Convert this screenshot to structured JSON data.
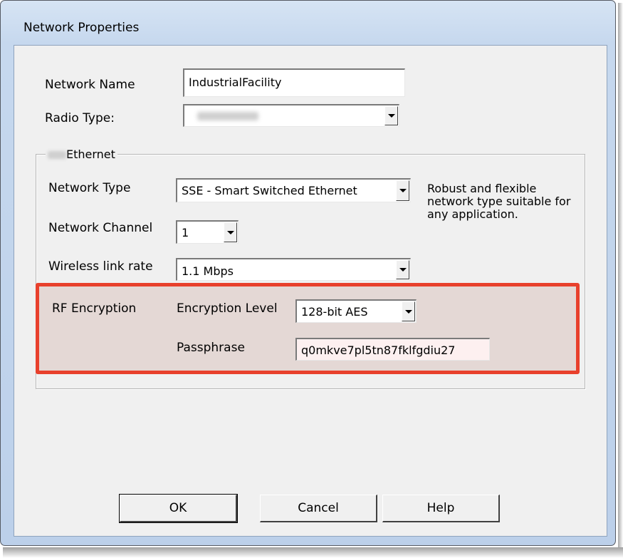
{
  "window": {
    "title": "Network Properties"
  },
  "network_name": {
    "label": "Network Name",
    "value": "IndustrialFacility"
  },
  "radio_type": {
    "label": "Radio Type:",
    "value": ""
  },
  "group": {
    "caption": "Ethernet"
  },
  "network_type": {
    "label": "Network Type",
    "value": "SSE - Smart Switched Ethernet",
    "description": [
      "Robust and flexible",
      "network type suitable for",
      "any application."
    ]
  },
  "network_channel": {
    "label": "Network Channel",
    "value": "1"
  },
  "wireless_link_rate": {
    "label": "Wireless link rate",
    "value": "1.1 Mbps"
  },
  "rf_encryption": {
    "label": "RF Encryption",
    "level_label": "Encryption Level",
    "level_value": "128-bit AES",
    "passphrase_label": "Passphrase",
    "passphrase_value": "q0mkve7pl5tn87fklfgdiu27"
  },
  "buttons": {
    "ok": "OK",
    "cancel": "Cancel",
    "help": "Help"
  },
  "colors": {
    "highlight_border": "#e8402c",
    "highlight_fill": "#e4d8d5",
    "dialog_bg": "#f0f0f0",
    "title_bar": "#c6d8ee"
  },
  "icons": {
    "dropdown": "chevron-down-icon"
  }
}
